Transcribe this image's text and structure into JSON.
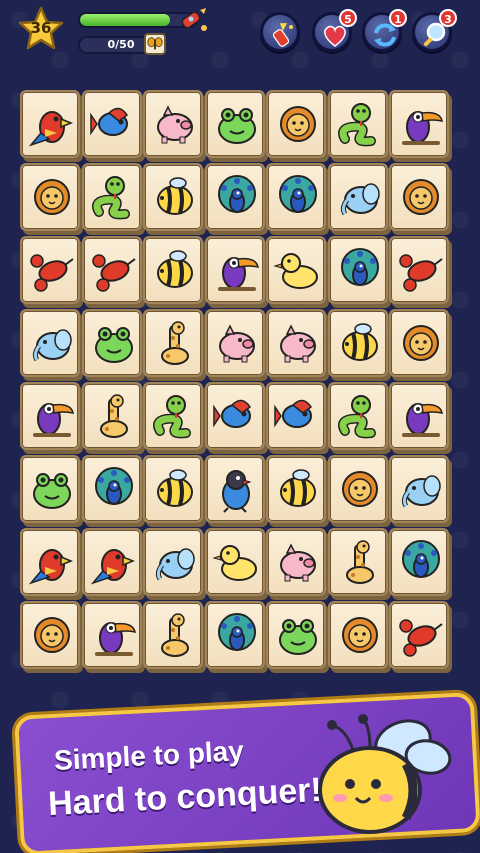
{
  "hud": {
    "level": "36",
    "progress_fraction": 0.78,
    "pairs_text": "0/50",
    "powerups": [
      {
        "name": "rocket",
        "badge": ""
      },
      {
        "name": "heart",
        "badge": "5"
      },
      {
        "name": "shuffle",
        "badge": "1"
      },
      {
        "name": "magnifier",
        "badge": "3"
      }
    ]
  },
  "board": {
    "rows": [
      [
        "parrot",
        "fish",
        "pig",
        "frog",
        "lion",
        "snake",
        "toucan"
      ],
      [
        "lion",
        "snake",
        "bee",
        "peacock",
        "peacock",
        "elephant",
        "lion"
      ],
      [
        "lobster",
        "lobster",
        "bee",
        "toucan",
        "duck",
        "peacock",
        "lobster"
      ],
      [
        "elephant",
        "frog",
        "giraffe",
        "pig",
        "pig",
        "bee",
        "lion"
      ],
      [
        "toucan",
        "giraffe",
        "snake",
        "fish",
        "fish",
        "snake",
        "toucan"
      ],
      [
        "frog",
        "peacock",
        "bee",
        "lovebird",
        "bee",
        "lion",
        "elephant"
      ],
      [
        "parrot",
        "parrot",
        "elephant",
        "duck",
        "pig",
        "giraffe",
        "peacock"
      ],
      [
        "lion",
        "toucan",
        "giraffe",
        "peacock",
        "frog",
        "lion",
        "lobster"
      ]
    ]
  },
  "banner": {
    "line1": "Simple to play",
    "line2": "Hard to conquer!"
  },
  "colors": {
    "background": "#1e2350",
    "tile": "#f6e6c8",
    "banner": "#7a40c4",
    "banner_border": "#f7c845"
  }
}
